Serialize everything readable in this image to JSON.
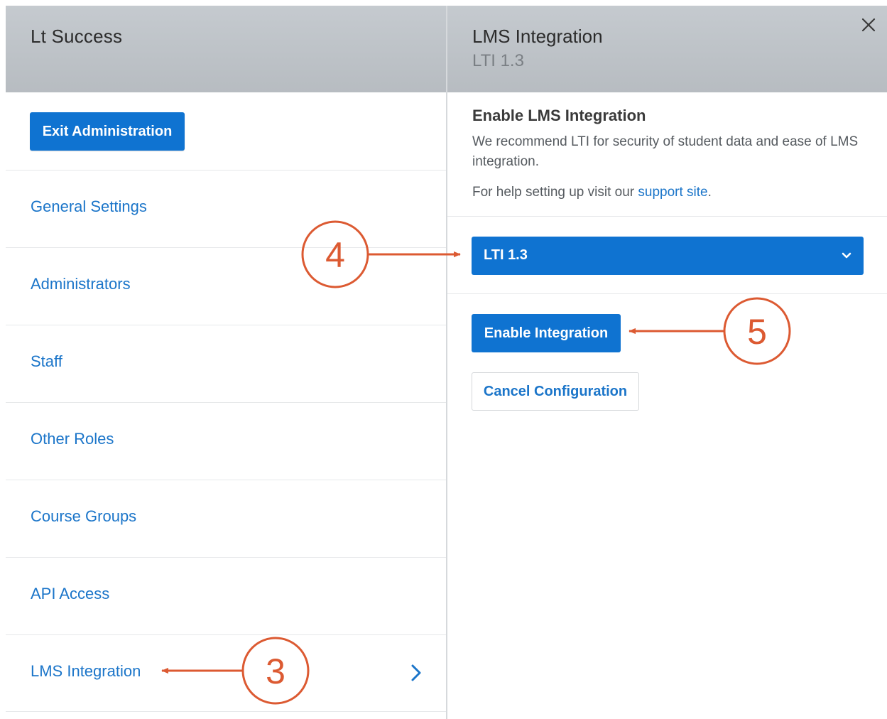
{
  "left_panel": {
    "title": "Lt Success",
    "exit_button": "Exit Administration",
    "nav_items": [
      {
        "label": "General Settings"
      },
      {
        "label": "Administrators"
      },
      {
        "label": "Staff"
      },
      {
        "label": "Other Roles"
      },
      {
        "label": "Course Groups"
      },
      {
        "label": "API Access"
      },
      {
        "label": "LMS Integration",
        "selected": true
      }
    ]
  },
  "right_panel": {
    "title": "LMS Integration",
    "subtitle": "LTI 1.3",
    "section_heading": "Enable LMS Integration",
    "description": "We recommend LTI for security of student data and ease of LMS integration.",
    "help_prefix": "For help setting up visit our ",
    "help_link": "support site",
    "help_suffix": ".",
    "select_value": "LTI 1.3",
    "enable_button": "Enable Integration",
    "cancel_button": "Cancel Configuration"
  },
  "annotations": [
    {
      "number": "3",
      "target": "nav-item-lms-integration"
    },
    {
      "number": "4",
      "target": "lti-version-select"
    },
    {
      "number": "5",
      "target": "enable-integration-button"
    }
  ],
  "colors": {
    "primary": "#0f73d1",
    "link": "#1b75c9",
    "header_bg": "#bfc4c9",
    "annotation": "#dc5a32"
  }
}
